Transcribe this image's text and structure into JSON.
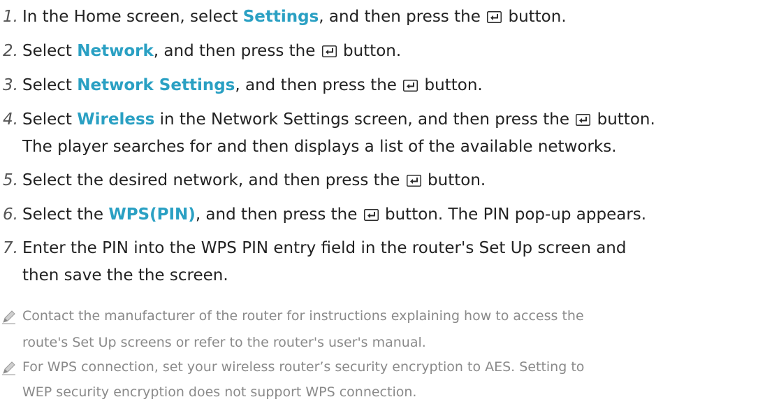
{
  "steps": [
    {
      "num": "1.",
      "parts": [
        "In the Home screen, select ",
        "Settings",
        ", and then press the ",
        " button."
      ]
    },
    {
      "num": "2.",
      "parts": [
        "Select ",
        "Network",
        ", and then press the ",
        " button."
      ]
    },
    {
      "num": "3.",
      "parts": [
        "Select ",
        "Network Settings",
        ", and then press the ",
        " button."
      ]
    },
    {
      "num": "4.",
      "parts": [
        "Select ",
        "Wireless",
        " in the Network Settings screen, and then press the ",
        " button."
      ],
      "line2": "The player searches for and then displays a list of the available networks."
    },
    {
      "num": "5.",
      "parts": [
        "Select the desired network, and then press the ",
        " button."
      ]
    },
    {
      "num": "6.",
      "parts": [
        "Select the ",
        "WPS(PIN)",
        ", and then press the ",
        " button. The PIN pop-up appears."
      ]
    },
    {
      "num": "7.",
      "line1": "Enter the PIN into the WPS PIN entry field in the router's Set Up screen and",
      "line2": "then save the the screen."
    }
  ],
  "notes": [
    {
      "line1": "Contact the manufacturer of the router for instructions explaining how to access the",
      "line2": "route's Set Up screens or refer to the router's user's manual."
    },
    {
      "line1": "For WPS connection, set your wireless router’s security encryption to AES. Setting to",
      "line2": "WEP security encryption does not support WPS connection."
    }
  ],
  "colors": {
    "highlight": "#2aa0c3",
    "note": "#8a8a8a"
  },
  "icons": {
    "enter": "enter-button-icon",
    "note": "pencil-note-icon"
  }
}
